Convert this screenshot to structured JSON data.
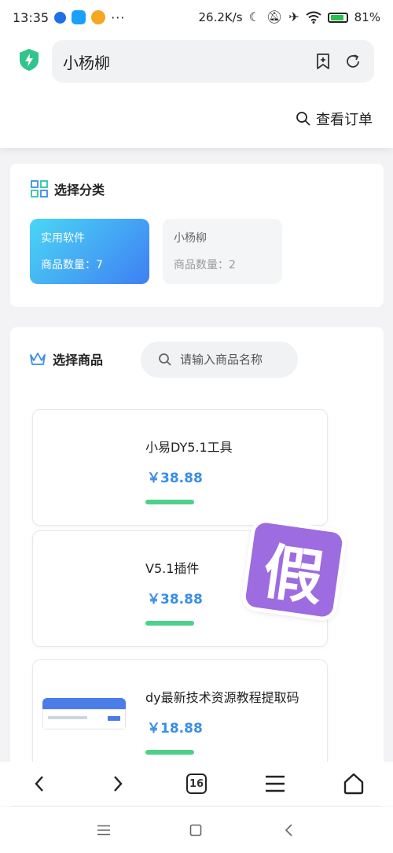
{
  "status_bar": {
    "time": "13:35",
    "network_speed": "26.2K/s",
    "battery": "81%",
    "icons": [
      "moon-icon",
      "mute-icon",
      "airplane-icon",
      "wifi-icon",
      "battery-icon"
    ]
  },
  "browser": {
    "site_title": "小杨柳",
    "tab_count": "16"
  },
  "header": {
    "order_link": "查看订单"
  },
  "categories": {
    "heading": "选择分类",
    "items": [
      {
        "name": "实用软件",
        "count": "商品数量：7",
        "selected": true
      },
      {
        "name": "小杨柳",
        "count": "商品数量：2",
        "selected": false
      }
    ]
  },
  "products": {
    "heading": "选择商品",
    "search_placeholder": "请输入商品名称",
    "items": [
      {
        "title": "小易DY5.1工具",
        "price": "￥38.88"
      },
      {
        "title": "V5.1插件",
        "price": "￥38.88"
      },
      {
        "title": "dy最新技术资源教程提取码",
        "price": "￥18.88"
      }
    ]
  },
  "watermark": {
    "text": "假"
  },
  "colors": {
    "accent": "#3a8ee6",
    "category_gradient_start": "#4ad6f5",
    "category_gradient_end": "#3f7ff3",
    "progress_green": "#4cd18a",
    "stamp_purple": "#9d6ce0"
  }
}
